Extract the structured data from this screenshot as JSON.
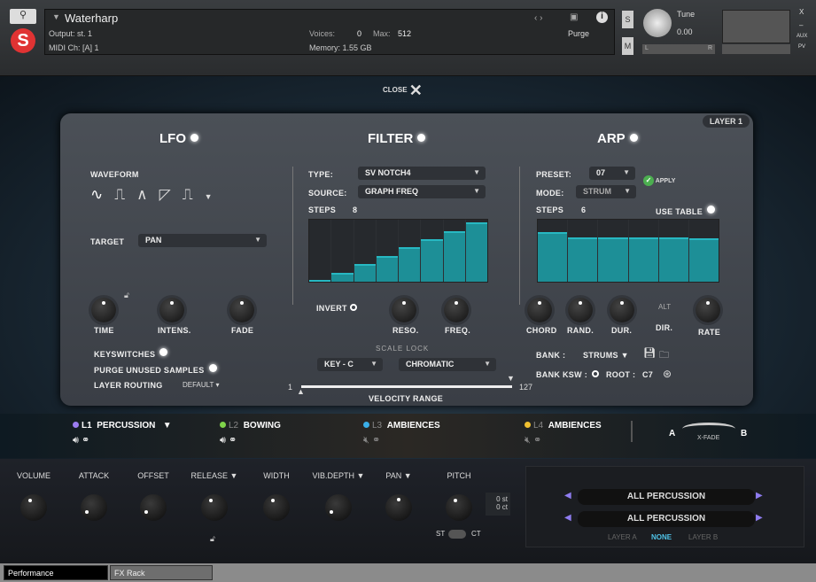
{
  "header": {
    "instrument": "Waterharp",
    "output": "Output: st. 1",
    "midi": "MIDI Ch: [A]  1",
    "voices_label": "Voices:",
    "voices": "0",
    "max_label": "Max:",
    "max": "512",
    "memory": "Memory: 1.55 GB",
    "purge": "Purge",
    "s": "S",
    "m": "M",
    "tune_label": "Tune",
    "tune": "0.00",
    "l": "L",
    "r": "R",
    "aux": "AUX",
    "pv": "PV",
    "x": "X",
    "minus": "–"
  },
  "close": "CLOSE",
  "layer_badge": "LAYER 1",
  "lfo": {
    "title": "LFO",
    "waveform": "WAVEFORM",
    "target_label": "TARGET",
    "target": "PAN",
    "knobs": [
      "TIME",
      "INTENS.",
      "FADE"
    ],
    "keyswitches": "KEYSWITCHES",
    "purge": "PURGE UNUSED SAMPLES",
    "routing": "LAYER ROUTING",
    "routing_value": "DEFAULT"
  },
  "filter": {
    "title": "FILTER",
    "type_label": "TYPE:",
    "type": "SV NOTCH4",
    "source_label": "SOURCE:",
    "source": "GRAPH FREQ",
    "steps_label": "STEPS",
    "steps": "8",
    "steps_values": [
      0.0,
      0.15,
      0.29,
      0.42,
      0.56,
      0.69,
      0.82,
      0.96
    ],
    "invert": "INVERT",
    "knobs": [
      "RESO.",
      "FREQ."
    ],
    "scale_lock": "SCALE LOCK",
    "key": "KEY - C",
    "scale": "CHROMATIC",
    "vel_min": "1",
    "vel_max": "127",
    "velocity": "VELOCITY RANGE"
  },
  "arp": {
    "title": "ARP",
    "preset_label": "PRESET:",
    "preset": "07",
    "apply": "APPLY",
    "mode_label": "MODE:",
    "mode": "STRUM",
    "steps_label": "STEPS",
    "steps": "6",
    "use_table": "USE TABLE",
    "steps_values": [
      0.8,
      0.72,
      0.72,
      0.72,
      0.72,
      0.7
    ],
    "knobs": [
      "CHORD",
      "RAND.",
      "DUR.",
      "RATE"
    ],
    "alt": "ALT",
    "dir": "DIR.",
    "bank_label": "BANK :",
    "bank": "STRUMS",
    "bank_ksw": "BANK KSW :",
    "root_label": "ROOT :",
    "root": "C7"
  },
  "layers": [
    {
      "id": "L1",
      "name": "PERCUSSION",
      "color": "#9b7cf0"
    },
    {
      "id": "L2",
      "name": "BOWING",
      "color": "#7fd34a"
    },
    {
      "id": "L3",
      "name": "AMBIENCES",
      "color": "#3aaee8"
    },
    {
      "id": "L4",
      "name": "AMBIENCES",
      "color": "#f0c030"
    }
  ],
  "xfade": {
    "a": "A",
    "b": "B",
    "label": "X-FADE"
  },
  "controls": [
    "VOLUME",
    "ATTACK",
    "OFFSET",
    "RELEASE ▼",
    "WIDTH",
    "VIB.DEPTH ▼",
    "PAN ▼",
    "PITCH"
  ],
  "pitch": {
    "st": "0 st",
    "ct": "0 ct",
    "st_toggle": "ST",
    "ct_toggle": "CT"
  },
  "selector": {
    "row1": "ALL PERCUSSION",
    "row2": "ALL PERCUSSION",
    "layer_a": "LAYER A",
    "none": "NONE",
    "layer_b": "LAYER B"
  },
  "tabs": [
    "Performance",
    "FX Rack"
  ]
}
